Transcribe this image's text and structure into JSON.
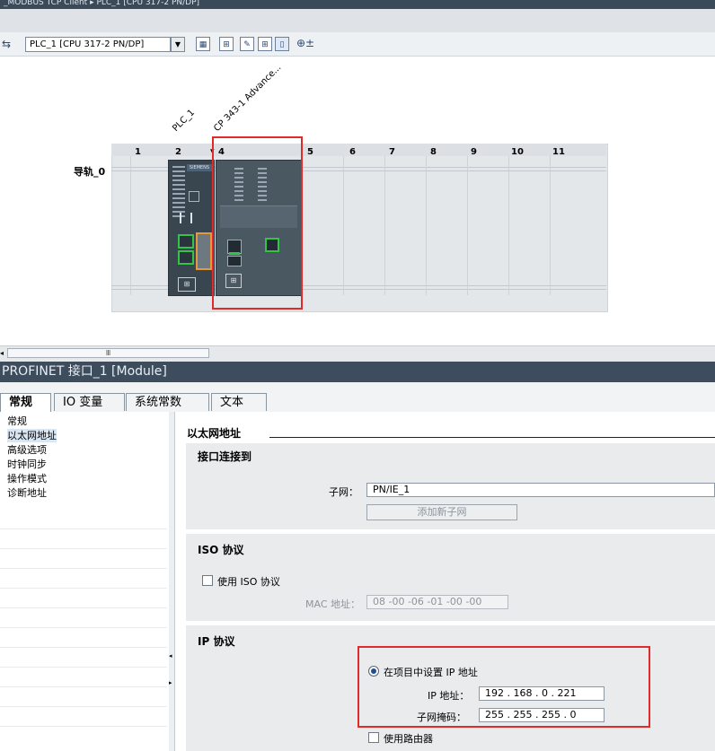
{
  "window": {
    "title": "_MODBUS TCP Client ▸ PLC_1 [CPU 317-2 PN/DP]"
  },
  "toolbar": {
    "device_select": "PLC_1 [CPU 317-2 PN/DP]"
  },
  "rack": {
    "rail_label": "导轨_0",
    "slots": [
      "1",
      "2",
      "4",
      "5",
      "6",
      "7",
      "8",
      "9",
      "10",
      "11"
    ],
    "modules": [
      "PLC_1",
      "CP 343-1 Advance..."
    ],
    "module_brand": "SIEMENS"
  },
  "properties": {
    "header": "PROFINET 接口_1 [Module]",
    "tabs": [
      "常规",
      "IO 变量",
      "系统常数",
      "文本"
    ],
    "nav": [
      "常规",
      "以太网地址",
      "高级选项",
      "时钟同步",
      "操作模式",
      "诊断地址"
    ],
    "group_title": "以太网地址",
    "interface": {
      "title": "接口连接到",
      "subnet_label": "子网：",
      "subnet_value": "PN/IE_1",
      "add_subnet_button": "添加新子网"
    },
    "iso": {
      "title": "ISO 协议",
      "use_iso_label": "使用 ISO 协议",
      "mac_label": "MAC 地址：",
      "mac_value": "08 -00 -06 -01 -00 -00"
    },
    "ip": {
      "title": "IP 协议",
      "set_in_project_label": "在项目中设置 IP 地址",
      "ip_label": "IP 地址：",
      "ip_value": "192  .  168  .  0     .  221",
      "mask_label": "子网掩码：",
      "mask_value": "255  .  255  .  255  .  0",
      "router_label": "使用路由器"
    }
  }
}
